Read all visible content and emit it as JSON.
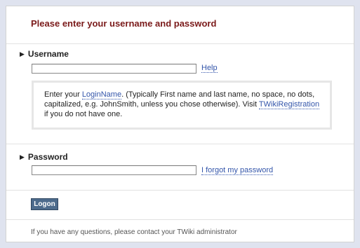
{
  "title": "Please enter your username and password",
  "username": {
    "label": "Username",
    "value": "",
    "help_link": "Help"
  },
  "help_box": {
    "prefix": "Enter your ",
    "loginname_link": "LoginName",
    "middle": ". (Typically First name and last name, no space, no dots, capitalized, e.g. JohnSmith, unless you chose otherwise). Visit ",
    "registration_link": "TWikiRegistration",
    "suffix": " if you do not have one."
  },
  "password": {
    "label": "Password",
    "value": "",
    "forgot_link": "I forgot my password"
  },
  "logon_button": "Logon",
  "footer": "If you have any questions, please contact your TWiki administrator",
  "colors": {
    "title": "#7a1a1a",
    "link": "#3355aa",
    "button": "#4d6b8c",
    "background": "#dfe3ef"
  },
  "icons": {
    "field_marker": "triangle-right-icon"
  }
}
